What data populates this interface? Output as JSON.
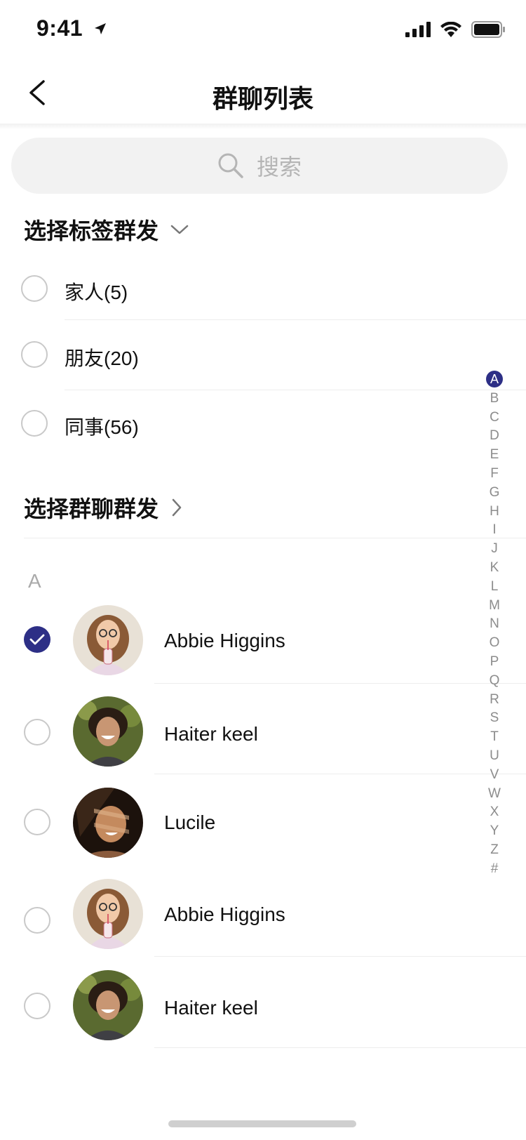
{
  "status_bar": {
    "time": "9:41"
  },
  "nav": {
    "title": "群聊列表"
  },
  "search": {
    "placeholder": "搜索"
  },
  "tag_section": {
    "title": "选择标签群发",
    "tags": [
      {
        "label": "家人(5)"
      },
      {
        "label": "朋友(20)"
      },
      {
        "label": "同事(56)"
      }
    ]
  },
  "group_section": {
    "title": "选择群聊群发"
  },
  "contacts": {
    "group_letter": "A",
    "items": [
      {
        "name": "Abbie Higgins",
        "checked": true,
        "avatar": "woman-glasses-drink"
      },
      {
        "name": "Haiter keel",
        "checked": false,
        "avatar": "woman-curly-laughing"
      },
      {
        "name": "Lucile",
        "checked": false,
        "avatar": "woman-shadow-smiling"
      },
      {
        "name": "Abbie Higgins",
        "checked": false,
        "avatar": "woman-glasses-drink"
      },
      {
        "name": "Haiter keel",
        "checked": false,
        "avatar": "woman-curly-laughing"
      }
    ]
  },
  "alphabet_index": [
    "A",
    "B",
    "C",
    "D",
    "E",
    "F",
    "G",
    "H",
    "I",
    "J",
    "K",
    "L",
    "M",
    "N",
    "O",
    "P",
    "Q",
    "R",
    "S",
    "T",
    "U",
    "V",
    "W",
    "X",
    "Y",
    "Z",
    "#"
  ],
  "colors": {
    "accent": "#2d2f86",
    "divider": "#ededed",
    "placeholder": "#b5b5b5"
  }
}
